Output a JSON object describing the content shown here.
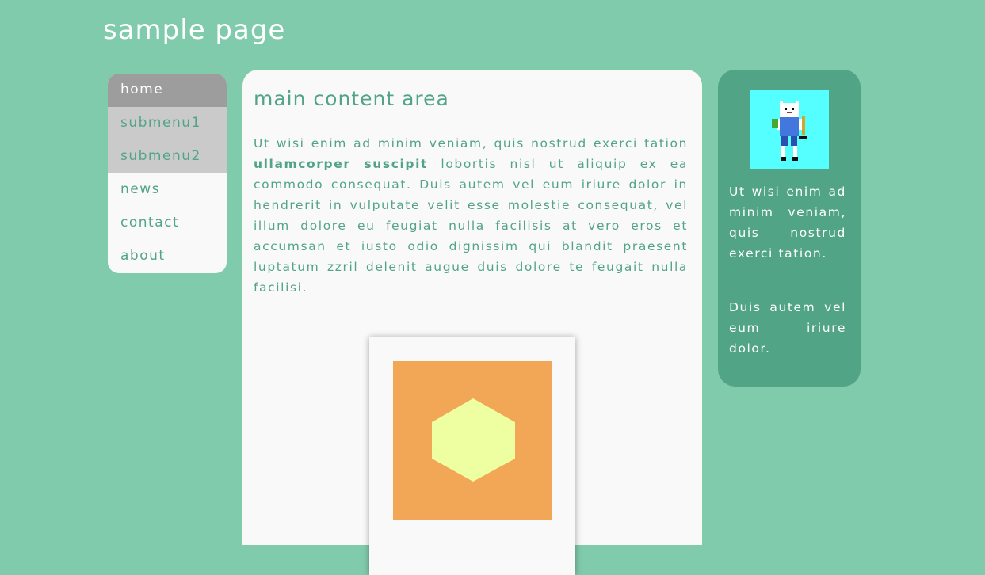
{
  "site": {
    "title": "sample page"
  },
  "nav": {
    "items": [
      {
        "label": "home",
        "state": "active"
      },
      {
        "label": "submenu1",
        "state": "sub"
      },
      {
        "label": "submenu2",
        "state": "sub"
      },
      {
        "label": "news",
        "state": "normal"
      },
      {
        "label": "contact",
        "state": "normal"
      },
      {
        "label": "about",
        "state": "normal"
      }
    ]
  },
  "main": {
    "heading": "main content area",
    "paragraph": {
      "before": "Ut wisi enim ad minim veniam, quis nostrud exerci tation ",
      "bold": "ullamcorper suscipit",
      "after": " lobortis nisl ut aliquip ex ea commodo consequat. Duis autem vel eum iriure dolor in hendrerit in vulputate velit esse molestie consequat, vel illum dolore eu feugiat nulla facilisis at vero eros et accumsan et iusto odio dignissim qui blandit praesent luptatum zzril delenit augue duis dolore te feugait nulla facilisi."
    },
    "image": {
      "icon": "hexagon-graphic",
      "background_color": "#f2a757",
      "shape_color": "#eeffa2"
    }
  },
  "sidebar": {
    "avatar": {
      "icon": "pixel-character-icon",
      "background_color": "#56ffff"
    },
    "paragraphs": [
      "Ut wisi enim ad minim veniam, quis nostrud exerci tation.",
      "Duis autem vel eum iriure dolor."
    ]
  },
  "colors": {
    "background": "#80cbab",
    "accent": "#52a487",
    "panel": "#f9f9f9",
    "nav_active": "#9d9d9d",
    "nav_sub": "#cacaca"
  }
}
